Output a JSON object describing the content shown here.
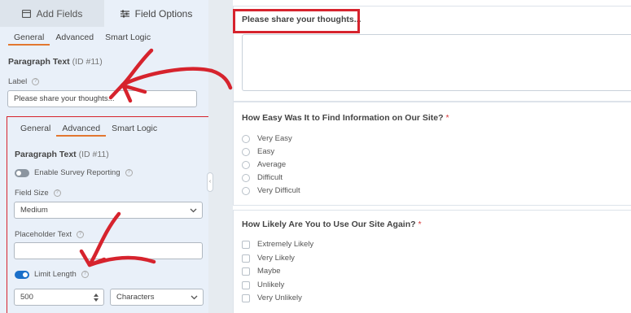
{
  "top_tabs": {
    "add_fields": "Add Fields",
    "field_options": "Field Options"
  },
  "upper": {
    "tabs": [
      "General",
      "Advanced",
      "Smart Logic"
    ],
    "field_title": "Paragraph Text",
    "field_id": "(ID #11)",
    "label_caption": "Label",
    "label_value": "Please share your thoughts..."
  },
  "lower": {
    "tabs": [
      "General",
      "Advanced",
      "Smart Logic"
    ],
    "field_title": "Paragraph Text",
    "field_id": "(ID #11)",
    "survey_label": "Enable Survey Reporting",
    "field_size_caption": "Field Size",
    "field_size_value": "Medium",
    "placeholder_caption": "Placeholder Text",
    "placeholder_value": "",
    "limit_label": "Limit Length",
    "limit_value": "500",
    "limit_unit": "Characters"
  },
  "preview": {
    "q1_label": "Please share your thoughts...",
    "q2_label": "How Easy Was It to Find Information on Our Site?",
    "q2_required": "*",
    "q2_options": [
      "Very Easy",
      "Easy",
      "Average",
      "Difficult",
      "Very Difficult"
    ],
    "q3_label": "How Likely Are You to Use Our Site Again?",
    "q3_required": "*",
    "q3_options": [
      "Extremely Likely",
      "Very Likely",
      "Maybe",
      "Unlikely",
      "Very Unlikely"
    ]
  },
  "colors": {
    "accent": "#e27730",
    "highlight_red": "#d6232d",
    "toggle_on": "#1a6fc9",
    "toggle_off": "#8b95a0",
    "sidebar_bg": "#e9f0f9"
  },
  "icons": [
    "add-fields-icon",
    "field-options-icon",
    "help-icon",
    "chevron-down-icon",
    "stepper-icon",
    "collapse-icon"
  ]
}
